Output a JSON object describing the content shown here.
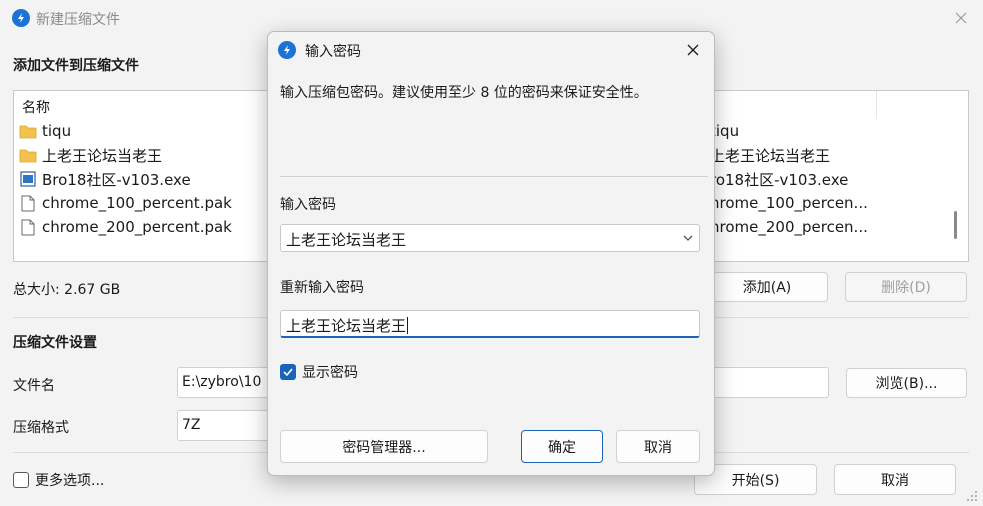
{
  "main_window": {
    "title": "新建压缩文件",
    "files_section_title": "添加文件到压缩文件",
    "file_list": {
      "column_header": "名称",
      "rows": [
        {
          "name": "tiqu",
          "icon": "folder-icon"
        },
        {
          "name": "上老王论坛当老王",
          "icon": "folder-icon"
        },
        {
          "name": "Bro18社区-v103.exe",
          "icon": "exe-icon"
        },
        {
          "name": "chrome_100_percent.pak",
          "icon": "file-icon"
        },
        {
          "name": "chrome_200_percent.pak",
          "icon": "file-icon"
        }
      ],
      "right_rows": [
        "tiqu",
        "上老王论坛当老王",
        "ro18社区-v103.exe",
        "hrome_100_percen...",
        "hrome_200_percen..."
      ]
    },
    "total_size": "总大小: 2.67 GB",
    "add_button": "添加(A)",
    "delete_button": "删除(D)",
    "settings_section_title": "压缩文件设置",
    "filename_label": "文件名",
    "filename_value": "E:\\zybro\\10",
    "format_label": "压缩格式",
    "format_value": "7Z",
    "browse_button": "浏览(B)...",
    "more_options": "更多选项...",
    "start_button": "开始(S)",
    "cancel_button": "取消"
  },
  "dialog": {
    "title": "输入密码",
    "description": "输入压缩包密码。建议使用至少 8 位的密码来保证安全性。",
    "password_label": "输入密码",
    "password_value": "上老王论坛当老王",
    "confirm_label": "重新输入密码",
    "confirm_value": "上老王论坛当老王",
    "show_password_label": "显示密码",
    "show_password_checked": true,
    "password_manager_button": "密码管理器...",
    "ok_button": "确定",
    "cancel_button": "取消"
  },
  "colors": {
    "accent": "#1b63b8",
    "app_icon": "#1b73d6",
    "folder": "#f2c14e"
  }
}
